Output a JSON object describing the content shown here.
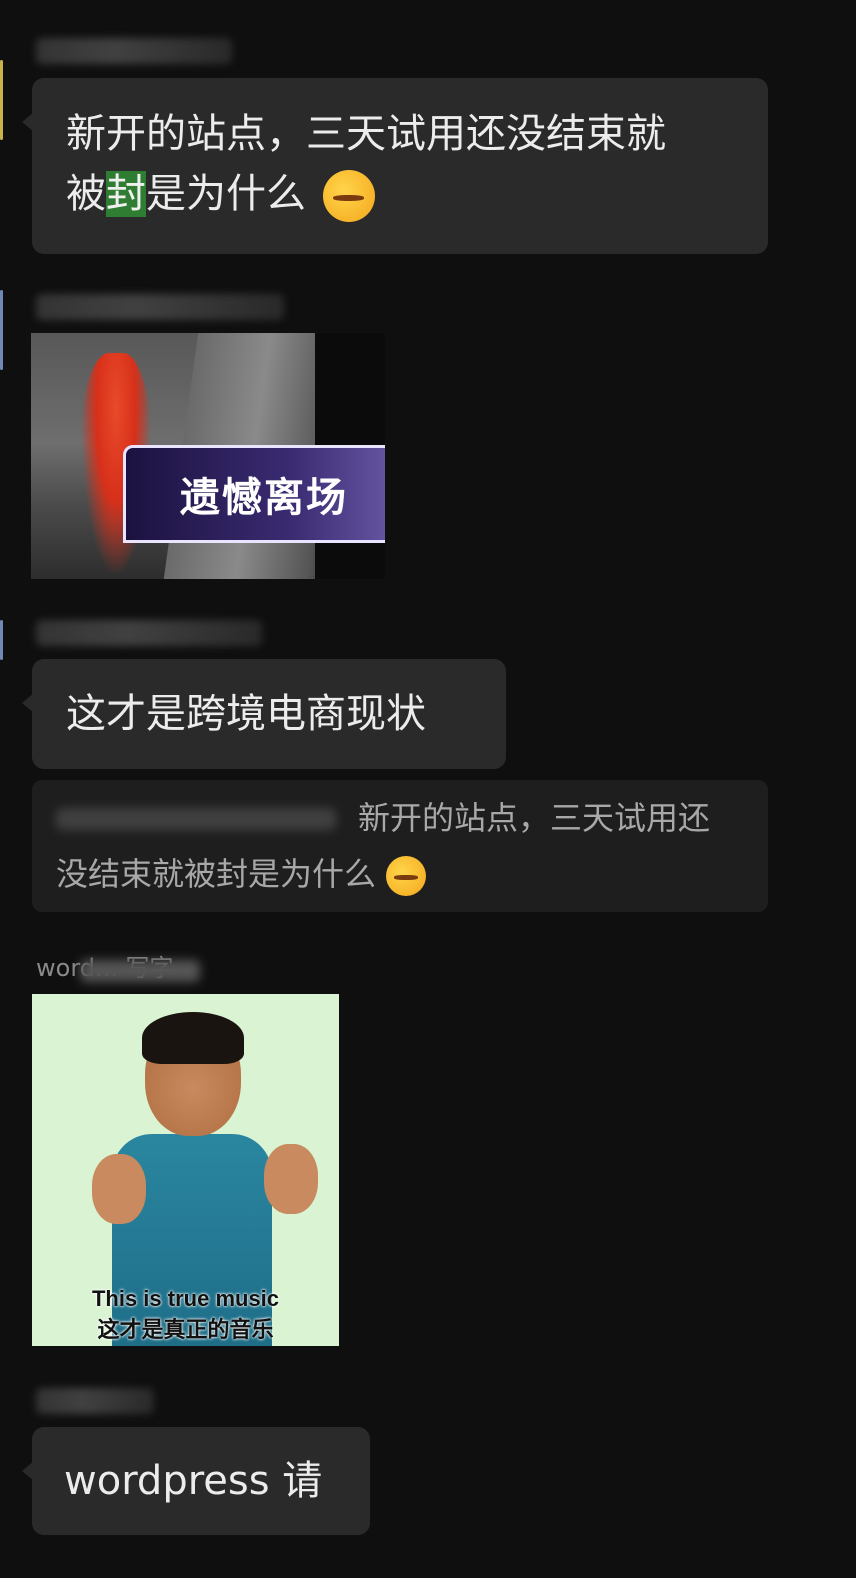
{
  "messages": [
    {
      "type": "text",
      "text_line1": "新开的站点，三天试用还没结束就",
      "text_line2_before": "被",
      "text_line2_highlight": "封",
      "text_line2_after": "是为什么",
      "emoji": "face-with-hand-over-mouth-tears-icon"
    },
    {
      "type": "image",
      "caption": "遗憾离场"
    },
    {
      "type": "text",
      "text": "这才是跨境电商现状"
    },
    {
      "type": "quote",
      "text_line1": "新开的站点，三天试用还",
      "text_line2": "没结束就被封是为什么",
      "emoji": "face-with-hand-over-mouth-tears-icon"
    },
    {
      "type": "image",
      "caption_en": "This is true music",
      "caption_zh": "这才是真正的音乐"
    },
    {
      "type": "text",
      "text": "wordpress 请"
    }
  ],
  "senders": {
    "msg5": "word... 写字"
  },
  "colors": {
    "background": "#0f0f0f",
    "bubble": "#2a2a2a",
    "quote": "#1e1e1e",
    "highlight": "#2f7d32"
  }
}
